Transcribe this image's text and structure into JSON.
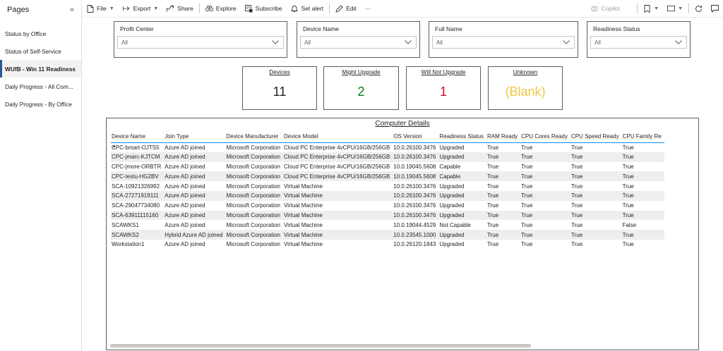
{
  "sidebar": {
    "title": "Pages",
    "collapse_icon": "«",
    "items": [
      {
        "label": "Status by Office"
      },
      {
        "label": "Status of Self-Service"
      },
      {
        "label": "WUfB - Win 11 Readiness",
        "active": true
      },
      {
        "label": "Daily Progress - All Com..."
      },
      {
        "label": "Daily Progress - By Office"
      }
    ]
  },
  "toolbar": {
    "file": "File",
    "export": "Export",
    "share": "Share",
    "explore": "Explore",
    "subscribe": "Subscribe",
    "set_alert": "Set alert",
    "edit": "Edit",
    "more": "···",
    "copilot": "Copilot"
  },
  "slicers": [
    {
      "label": "Profit Center",
      "value": "All"
    },
    {
      "label": "Device Name",
      "value": "All"
    },
    {
      "label": "Full Name",
      "value": "All"
    },
    {
      "label": "Readiness Status",
      "value": "All"
    }
  ],
  "cards": [
    {
      "title": "Devices",
      "value": "11",
      "color": "#252423"
    },
    {
      "title": "Might Upgrade",
      "value": "2",
      "color": "#107c10"
    },
    {
      "title": "Will Not Upgrade",
      "value": "1",
      "color": "#c50f1f"
    },
    {
      "title": "Unknown",
      "value": "(Blank)",
      "color": "#f2c744"
    }
  ],
  "table": {
    "title": "Computer Details",
    "columns": [
      "Device Name",
      "Join Type",
      "Device Manufacturer",
      "Device Model",
      "OS Version",
      "Readiness Status",
      "RAM Ready",
      "CPU Cores Ready",
      "CPU Speed Ready",
      "CPU Family Re"
    ],
    "rows": [
      [
        "CPC-bmart-OJTS5",
        "Azure AD joined",
        "Microsoft Corporation",
        "Cloud PC Enterprise 4vCPU/16GB/256GB",
        "10.0.26100.3476",
        "Upgraded",
        "True",
        "True",
        "True",
        "True"
      ],
      [
        "CPC-jmarc-KJTCM",
        "Azure AD joined",
        "Microsoft Corporation",
        "Cloud PC Enterprise 4vCPU/16GB/256GB",
        "10.0.26100.3476",
        "Upgraded",
        "True",
        "True",
        "True",
        "True"
      ],
      [
        "CPC-jmore-ORBTR",
        "Azure AD joined",
        "Microsoft Corporation",
        "Cloud PC Enterprise 4vCPU/16GB/256GB",
        "10.0.19045.5608",
        "Capable",
        "True",
        "True",
        "True",
        "True"
      ],
      [
        "CPC-testu-HG2BV",
        "Azure AD joined",
        "Microsoft Corporation",
        "Cloud PC Enterprise 4vCPU/16GB/256GB",
        "10.0.19045.5608",
        "Capable",
        "True",
        "True",
        "True",
        "True"
      ],
      [
        "SCA-10921326992",
        "Azure AD joined",
        "Microsoft Corporation",
        "Virtual Machine",
        "10.0.26100.3476",
        "Upgraded",
        "True",
        "True",
        "True",
        "True"
      ],
      [
        "SCA-27271919111",
        "Azure AD joined",
        "Microsoft Corporation",
        "Virtual Machine",
        "10.0.26100.3476",
        "Upgraded",
        "True",
        "True",
        "True",
        "True"
      ],
      [
        "SCA-29047734080",
        "Azure AD joined",
        "Microsoft Corporation",
        "Virtual Machine",
        "10.0.26100.3476",
        "Upgraded",
        "True",
        "True",
        "True",
        "True"
      ],
      [
        "SCA-63911115160",
        "Azure AD joined",
        "Microsoft Corporation",
        "Virtual Machine",
        "10.0.26100.3476",
        "Upgraded",
        "True",
        "True",
        "True",
        "True"
      ],
      [
        "SCAWKS1",
        "Azure AD joined",
        "Microsoft Corporation",
        "Virtual Machine",
        "10.0.19044.4529",
        "Not Capable",
        "True",
        "True",
        "True",
        "False"
      ],
      [
        "SCAWKS2",
        "Hybrid Azure AD joined",
        "Microsoft Corporation",
        "Virtual Machine",
        "10.0.23545.1000",
        "Upgraded",
        "True",
        "True",
        "True",
        "True"
      ],
      [
        "Workstation1",
        "Azure AD joined",
        "Microsoft Corporation",
        "Virtual Machine",
        "10.0.26120.1843",
        "Upgraded",
        "True",
        "True",
        "True",
        "True"
      ]
    ]
  }
}
